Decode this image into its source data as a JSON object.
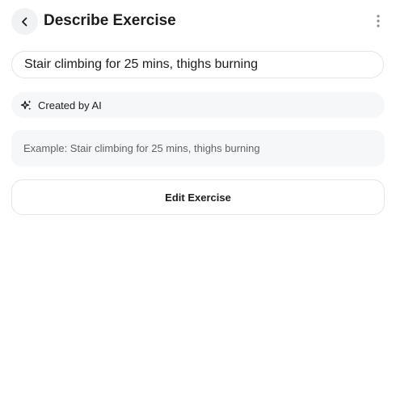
{
  "header": {
    "title": "Describe Exercise",
    "back_icon": "chevron-left-icon",
    "more_icon": "more-vertical-icon"
  },
  "description_input": {
    "value": "Stair climbing for 25 mins, thighs burning",
    "placeholder": ""
  },
  "ai_badge": {
    "icon": "sparkles-icon",
    "label": "Created by AI"
  },
  "example": {
    "text": "Example: Stair climbing for 25 mins, thighs burning"
  },
  "actions": {
    "edit_label": "Edit Exercise"
  },
  "colors": {
    "background": "#ffffff",
    "surface": "#f6f7f9",
    "border": "#e3e5e8",
    "text": "#1c1c1e",
    "muted_text": "#5f6368"
  }
}
